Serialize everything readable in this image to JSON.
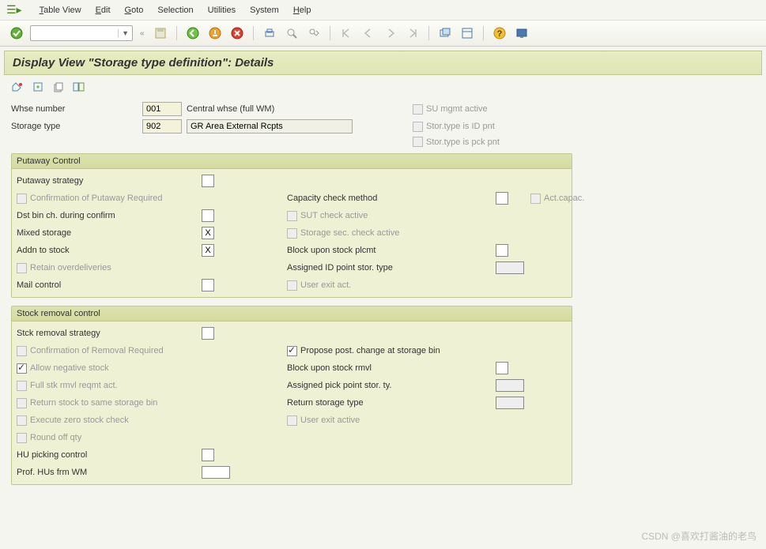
{
  "menu": {
    "table_view": "Table View",
    "edit": "Edit",
    "goto": "Goto",
    "selection": "Selection",
    "utilities": "Utilities",
    "system": "System",
    "help": "Help"
  },
  "title": "Display View \"Storage type definition\": Details",
  "header": {
    "whse_label": "Whse number",
    "whse_value": "001",
    "whse_desc": "Central whse (full WM)",
    "stype_label": "Storage type",
    "stype_value": "902",
    "stype_desc": "GR Area External Rcpts"
  },
  "flags": {
    "su_mgmt": "SU mgmt active",
    "id_pnt": "Stor.type is ID pnt",
    "pck_pnt": "Stor.type is pck pnt"
  },
  "putaway": {
    "title": "Putaway Control",
    "strategy": "Putaway strategy",
    "confirm": "Confirmation of Putaway Required",
    "dst_bin": "Dst bin ch. during confirm",
    "mixed": "Mixed storage",
    "mixed_val": "X",
    "addn": "Addn to stock",
    "addn_val": "X",
    "retain": "Retain overdeliveries",
    "mail": "Mail control",
    "cap_check": "Capacity check method",
    "act_capac": "Act.capac.",
    "sut": "SUT check active",
    "sec": "Storage sec. check active",
    "block": "Block upon stock plcmt",
    "assigned_id": "Assigned ID point stor. type",
    "user_exit": "User exit act."
  },
  "removal": {
    "title": "Stock removal control",
    "strategy": "Stck removal strategy",
    "confirm": "Confirmation of Removal Required",
    "neg": "Allow negative stock",
    "full": "Full stk rmvl reqmt act.",
    "return_same": "Return stock to same storage bin",
    "exec_zero": "Execute zero stock check",
    "round": "Round off qty",
    "hu_pick": "HU picking control",
    "prof_hu": "Prof. HUs frm WM",
    "propose": "Propose post. change at storage bin",
    "block": "Block upon stock rmvl",
    "assigned_pick": "Assigned pick point stor. ty.",
    "return_type": "Return storage type",
    "user_exit": "User exit active"
  },
  "watermark": "CSDN @喜欢打酱油的老鸟"
}
